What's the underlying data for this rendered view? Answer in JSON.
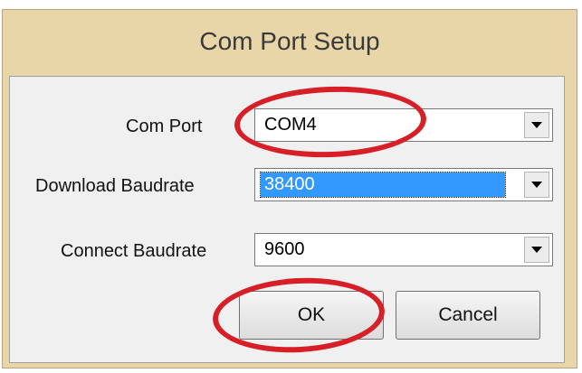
{
  "window": {
    "title": "Com Port Setup"
  },
  "form": {
    "com_port": {
      "label": "Com Port",
      "value": "COM4"
    },
    "download_baudrate": {
      "label": "Download Baudrate",
      "value": "38400"
    },
    "connect_baudrate": {
      "label": "Connect Baudrate",
      "value": "9600"
    }
  },
  "buttons": {
    "ok": "OK",
    "cancel": "Cancel"
  },
  "colors": {
    "frame": "#e8d6a8",
    "selection": "#3399ff",
    "annotation": "#d61f26"
  }
}
